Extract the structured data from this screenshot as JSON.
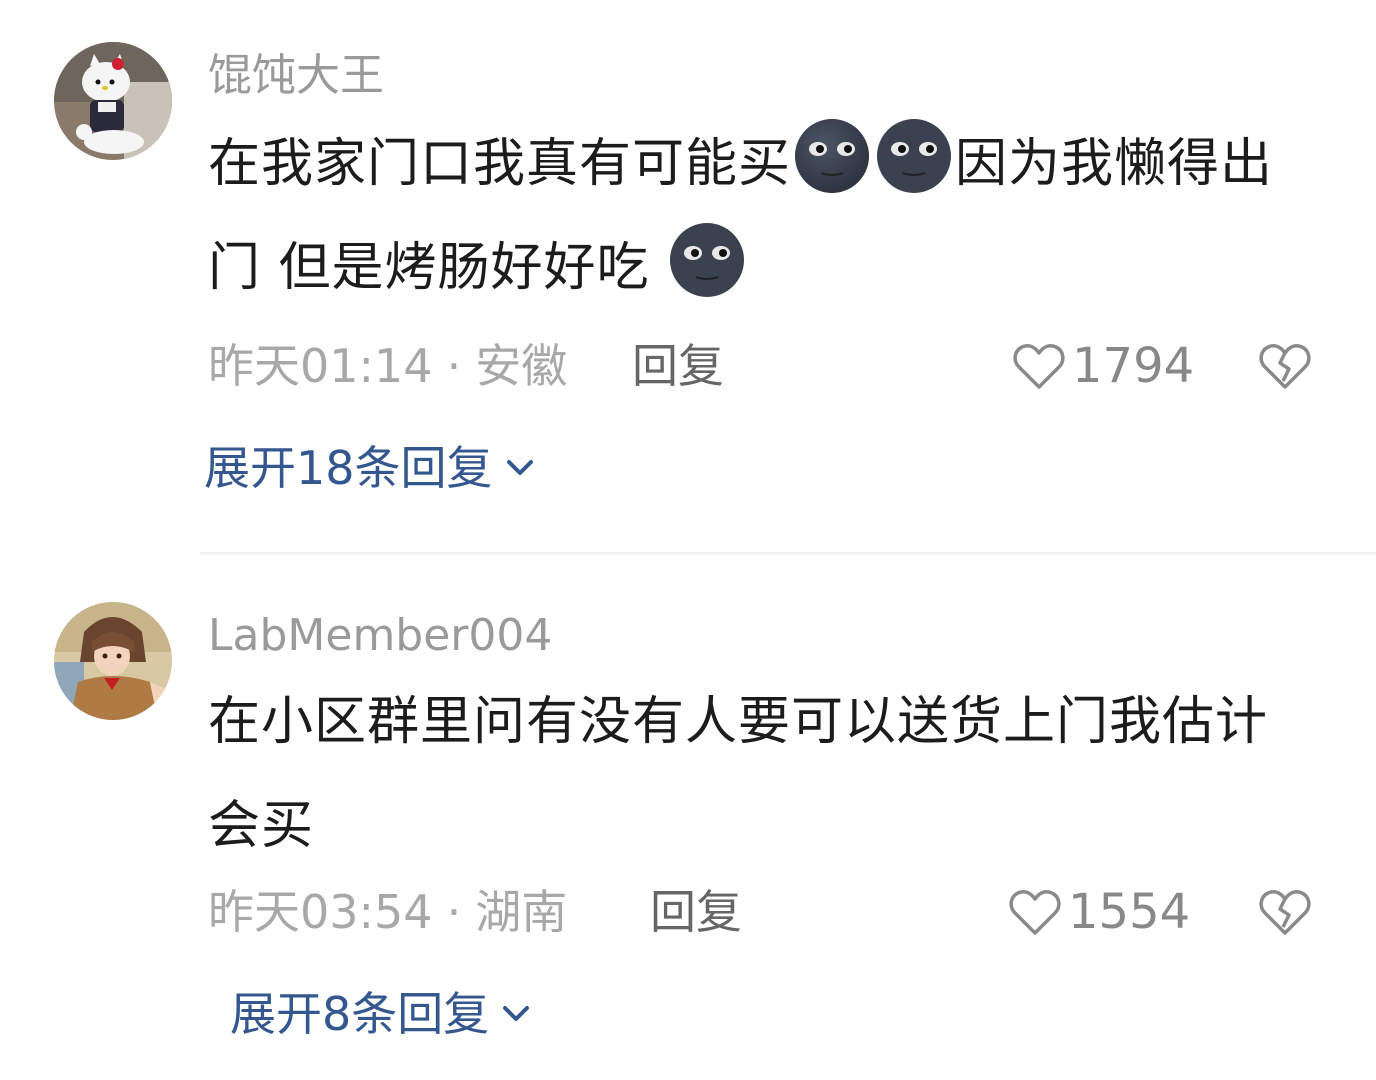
{
  "comments": [
    {
      "username": "馄饨大王",
      "text_part1": "在我家门口我真有可能买",
      "text_part2": "因为我懒得出门 但是烤肠好好吃",
      "time": "昨天01:14",
      "location": "安徽",
      "separator": "·",
      "reply_label": "回复",
      "likes": "1794",
      "expand_label": "展开18条回复",
      "avatar_icon": "hello-kitty-avatar",
      "emoji_icon": "new-moon-face-emoji"
    },
    {
      "username": "LabMember004",
      "text": "在小区群里问有没有人要可以送货上门我估计会买",
      "time": "昨天03:54",
      "location": "湖南",
      "separator": "·",
      "reply_label": "回复",
      "likes": "1554",
      "expand_label": "展开8条回复",
      "avatar_icon": "anime-character-avatar"
    }
  ],
  "colors": {
    "username": "#9a9a9a",
    "body": "#1c1c1c",
    "meta": "#a8a8a8",
    "expand_link": "#35578f"
  }
}
